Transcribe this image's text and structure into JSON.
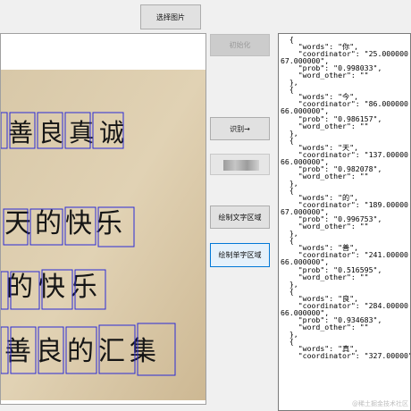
{
  "toolbar": {
    "select_image_label": "选择图片",
    "init_label": "初始化",
    "recognize_label": "识别→",
    "draw_text_region_label": "绘制文字区域",
    "draw_char_region_label": "绘制单字区域"
  },
  "image": {
    "lines": [
      "善良真诚",
      "天的快乐",
      "的快乐",
      "善良的汇集"
    ]
  },
  "json_output": {
    "text": "  {\n    \"words\": \"你\",\n    \"coordinator\": \"25.000000\n67.000000\",\n    \"prob\": \"0.998033\",\n    \"word_other\": \"\"\n  },\n  {\n    \"words\": \"今\",\n    \"coordinator\": \"86.000000\n66.000000\",\n    \"prob\": \"0.986157\",\n    \"word_other\": \"\"\n  },\n  {\n    \"words\": \"天\",\n    \"coordinator\": \"137.00000\n66.000000\",\n    \"prob\": \"0.982078\",\n    \"word_other\": \"\"\n  },\n  {\n    \"words\": \"的\",\n    \"coordinator\": \"189.00000\n67.000000\",\n    \"prob\": \"0.996753\",\n    \"word_other\": \"\"\n  },\n  {\n    \"words\": \"善\",\n    \"coordinator\": \"241.00000\n66.000000\",\n    \"prob\": \"0.516595\",\n    \"word_other\": \"\"\n  },\n  {\n    \"words\": \"良\",\n    \"coordinator\": \"284.00000\n66.000000\",\n    \"prob\": \"0.934683\",\n    \"word_other\": \"\"\n  },\n  {\n    \"words\": \"真\",\n    \"coordinator\": \"327.00000\""
  },
  "watermark": "@稀土掘金技术社区",
  "colors": {
    "box": "#2b2bd6",
    "paper": "#d9c7a6",
    "ink": "#111111",
    "focus": "#0078d7"
  }
}
